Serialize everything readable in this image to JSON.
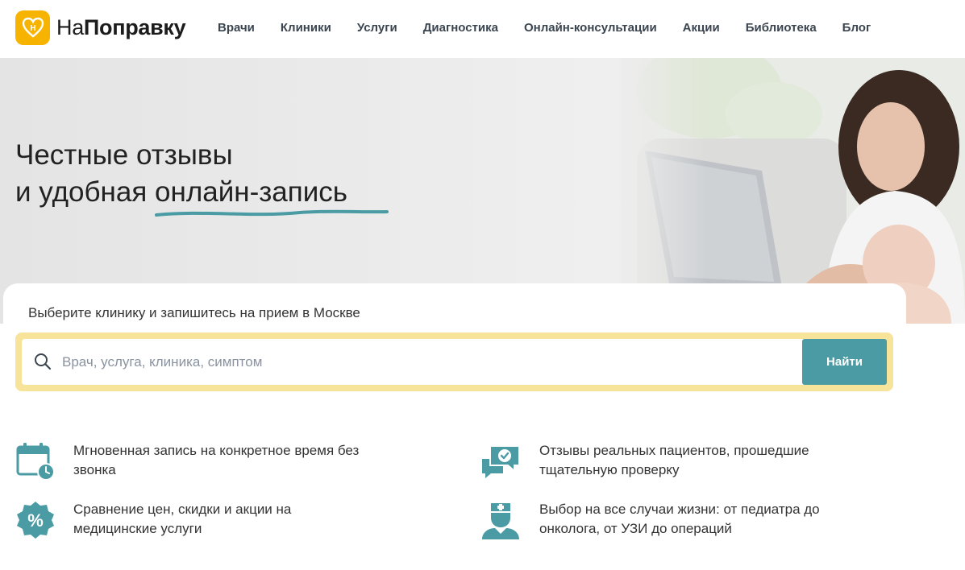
{
  "colors": {
    "brand_yellow": "#f6b400",
    "teal": "#4a9ba3",
    "search_border": "#f7e39a",
    "icon": "#4a9ba3"
  },
  "header": {
    "logo": {
      "prefix": "На",
      "bold": "Поправку",
      "icon": "heart-stethoscope-icon"
    },
    "nav": [
      "Врачи",
      "Клиники",
      "Услуги",
      "Диагностика",
      "Онлайн-консультации",
      "Акции",
      "Библиотека",
      "Блог"
    ]
  },
  "hero": {
    "line1": "Честные отзывы",
    "line2_prefix": "и удобная ",
    "line2_highlight": "онлайн-запись",
    "photo": "mother-with-baby-at-laptop-photo"
  },
  "search": {
    "label": "Выберите клинику и запишитесь на прием в Москве",
    "placeholder": "Врач, услуга, клиника, симптом",
    "value": "",
    "button": "Найти",
    "icon": "search-icon"
  },
  "features": [
    {
      "icon": "calendar-clock-icon",
      "text": "Мгновенная запись на конкретное время без звонка"
    },
    {
      "icon": "chat-review-check-icon",
      "text": "Отзывы реальных пациентов, прошедшие тщательную проверку"
    },
    {
      "icon": "percent-badge-icon",
      "text": "Сравнение цен, скидки и акции на медицинские услуги"
    },
    {
      "icon": "doctor-icon",
      "text": "Выбор на все случаи жизни: от педиатра до онколога, от УЗИ до операций"
    }
  ]
}
